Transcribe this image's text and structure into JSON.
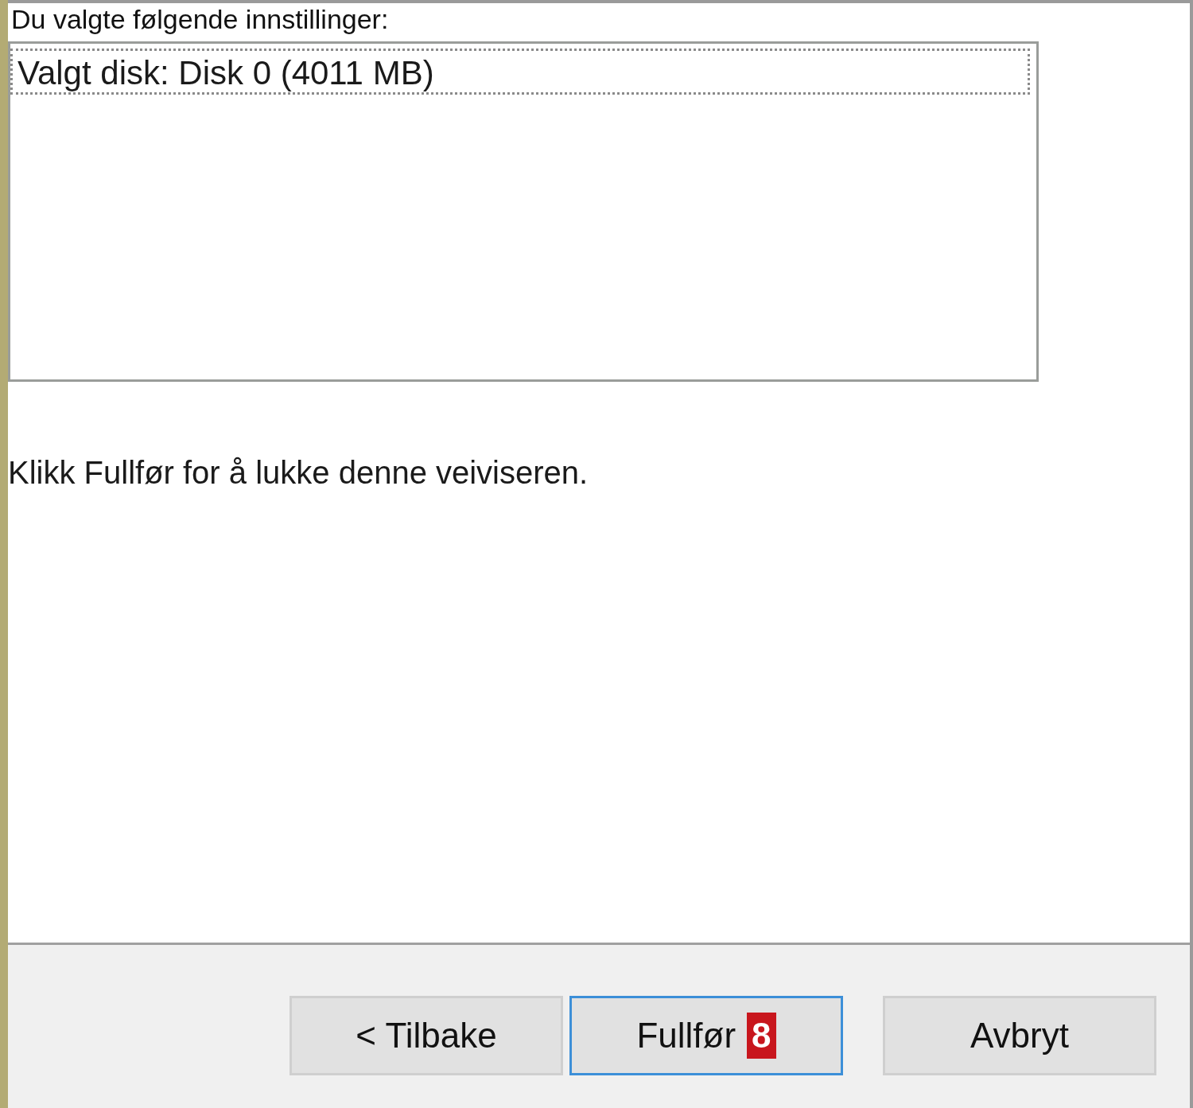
{
  "heading": "Du valgte følgende innstillinger:",
  "settings_list": {
    "items": [
      {
        "label": "Valgt disk: Disk 0 (4011 MB)",
        "focused": true
      }
    ]
  },
  "instruction": "Klikk Fullfør for å lukke denne veiviseren.",
  "buttons": [
    {
      "label": "< Tilbake",
      "focused": false
    },
    {
      "label": "Fullfør",
      "focused": true,
      "badge": "8"
    },
    {
      "label": "Avbryt",
      "focused": false
    }
  ]
}
